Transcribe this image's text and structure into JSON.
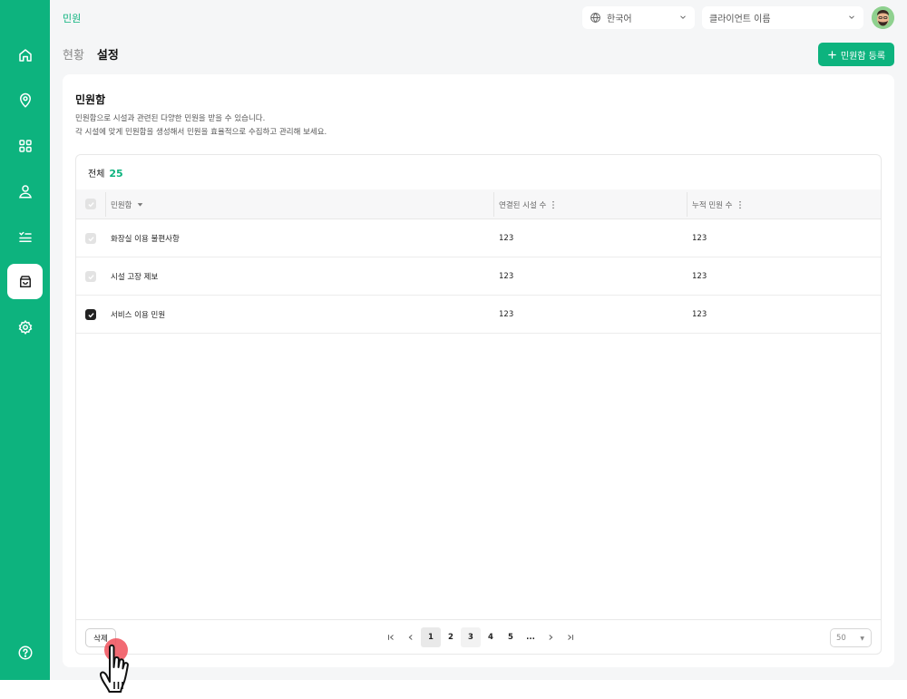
{
  "topbar": {
    "title": "민원",
    "language": {
      "value": "한국어",
      "icon": "globe-icon"
    },
    "client": {
      "placeholder": "클라이언트 이름"
    }
  },
  "sidebar": {
    "items": [
      {
        "name": "home",
        "icon": "home-icon",
        "active": false
      },
      {
        "name": "location",
        "icon": "map-pin-icon",
        "active": false
      },
      {
        "name": "apps",
        "icon": "grid-icon",
        "active": false
      },
      {
        "name": "user",
        "icon": "user-icon",
        "active": false
      },
      {
        "name": "checklist",
        "icon": "checklist-icon",
        "active": false
      },
      {
        "name": "inbox",
        "icon": "inbox-icon",
        "active": true
      },
      {
        "name": "settings",
        "icon": "gear-icon",
        "active": false
      }
    ],
    "help_icon": "help-icon"
  },
  "tabs": [
    {
      "label": "현황",
      "active": false
    },
    {
      "label": "설정",
      "active": true
    }
  ],
  "register_button": {
    "label": "민원함 등록",
    "icon": "plus-icon"
  },
  "card": {
    "title": "민원함",
    "description": [
      "민원함으로 시설과 관련된 다양한 민원을 받을 수 있습니다.",
      "각 시설에 맞게 민원함을 생성해서 민원을 효율적으로 수집하고 관리해 보세요."
    ]
  },
  "table": {
    "total_label": "전체",
    "total_count": "25",
    "columns": [
      "민원함",
      "연결된 시설 수",
      "누적 민원 수"
    ],
    "rows": [
      {
        "name": "화장실 이용 불편사항",
        "facilities": "123",
        "complaints": "123",
        "checked": false
      },
      {
        "name": "시설 고장 제보",
        "facilities": "123",
        "complaints": "123",
        "checked": false
      },
      {
        "name": "서비스 이용 민원",
        "facilities": "123",
        "complaints": "123",
        "checked": true
      }
    ]
  },
  "footer": {
    "delete_label": "삭제",
    "pages": [
      "1",
      "2",
      "3",
      "4",
      "5",
      "..."
    ],
    "current_page": "1",
    "page_size": "50"
  },
  "colors": {
    "accent": "#0db37e",
    "click_marker": "#f0505a"
  }
}
